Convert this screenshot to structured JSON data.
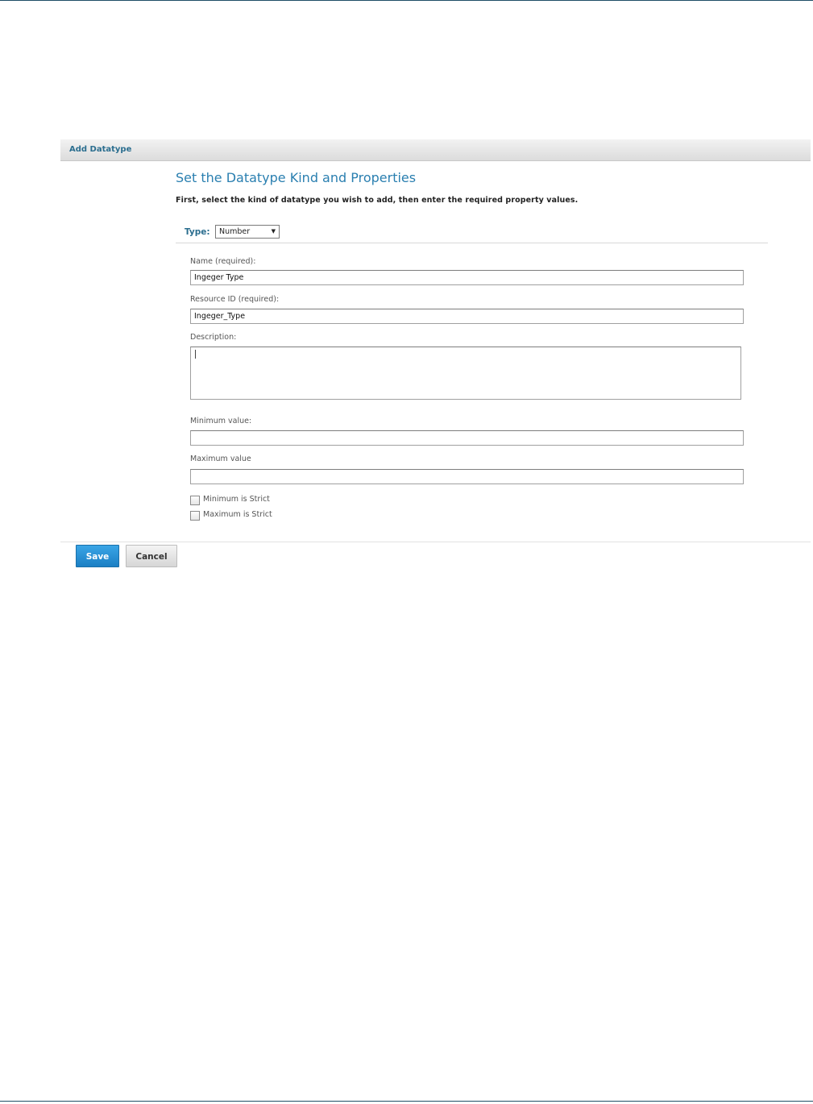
{
  "panel": {
    "title": "Add Datatype"
  },
  "form": {
    "heading": "Set the Datatype Kind and Properties",
    "instructions": "First, select the kind of datatype you wish to add, then enter the required property values.",
    "type_label": "Type:",
    "type_value": "Number",
    "name_label": "Name (required):",
    "name_value": "Ingeger Type",
    "resource_id_label": "Resource ID (required):",
    "resource_id_value": "Ingeger_Type",
    "description_label": "Description:",
    "description_value": "",
    "min_label": "Minimum value:",
    "min_value": "",
    "max_label": "Maximum value",
    "max_value": "",
    "min_strict_label": "Minimum is Strict",
    "max_strict_label": "Maximum is Strict"
  },
  "buttons": {
    "save": "Save",
    "cancel": "Cancel"
  },
  "colors": {
    "accent": "#2a7fb0",
    "save_button": "#1b7fc4"
  },
  "icons": {
    "type_dropdown": "chevron-down-icon"
  }
}
